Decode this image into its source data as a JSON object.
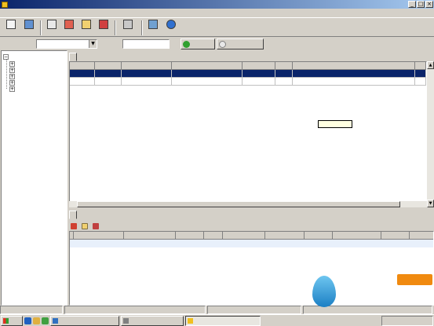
{
  "window": {
    "title": ""
  },
  "menu": [
    "",
    "",
    "",
    "",
    "",
    ""
  ],
  "toolbar": {
    "items": [
      {
        "label": "",
        "icon": "new-doc-icon"
      },
      {
        "label": "",
        "icon": "browse-icon"
      },
      {
        "label": "",
        "icon": "add-icon"
      },
      {
        "label": "",
        "icon": "query-icon"
      },
      {
        "label": "",
        "icon": "edit-icon"
      },
      {
        "label": "",
        "icon": "delete-icon"
      },
      {
        "label": "",
        "icon": "print-icon"
      },
      {
        "label": "",
        "icon": "summary-icon"
      },
      {
        "label": "",
        "icon": "help-icon"
      }
    ]
  },
  "search": {
    "field_label": "",
    "field_value": "",
    "keyword_label": "",
    "keyword_value": "",
    "query_button": "",
    "summary_button": ""
  },
  "tree": {
    "root": "",
    "children": [
      "",
      "",
      "",
      "",
      ""
    ]
  },
  "main_tab": "",
  "contracts": {
    "columns": [
      "",
      "",
      "",
      "",
      "",
      "",
      "",
      ""
    ],
    "rows": [
      {
        "n": "",
        "type": "",
        "id": "",
        "name": "",
        "amount": "",
        "status": "",
        "dept": "",
        "owner": ""
      },
      {
        "n": "",
        "type": "",
        "id": "",
        "name": "",
        "amount": "",
        "status": "",
        "dept": "",
        "owner": ""
      }
    ]
  },
  "tooltip": "",
  "sub_tab": "",
  "sub_toolbar": [
    "",
    "",
    ""
  ],
  "sub_grid": {
    "columns": [
      "",
      "",
      "",
      "",
      "",
      "",
      "",
      "",
      "",
      "",
      ""
    ]
  },
  "status": {
    "left": "",
    "path": ""
  },
  "taskbar": {
    "start": "",
    "buttons": [
      "",
      "",
      ""
    ],
    "tray": ""
  },
  "watermark": {
    "text": "",
    "badge": ""
  }
}
